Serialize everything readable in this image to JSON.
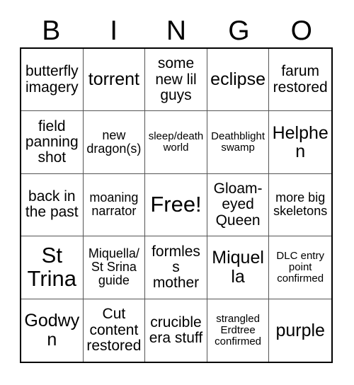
{
  "header": {
    "letters": [
      "B",
      "I",
      "N",
      "G",
      "O"
    ]
  },
  "grid": {
    "rows": 5,
    "columns": 5,
    "cells": [
      {
        "text": "butterfly imagery",
        "size": "lg",
        "free": false
      },
      {
        "text": "torrent",
        "size": "xl",
        "free": false
      },
      {
        "text": "some new lil guys",
        "size": "lg",
        "free": false
      },
      {
        "text": "eclipse",
        "size": "xl",
        "free": false
      },
      {
        "text": "farum restored",
        "size": "lg",
        "free": false
      },
      {
        "text": "field panning shot",
        "size": "lg",
        "free": false
      },
      {
        "text": "new dragon(s)",
        "size": "md",
        "free": false
      },
      {
        "text": "sleep/death world",
        "size": "sm",
        "free": false
      },
      {
        "text": "Deathblight swamp",
        "size": "sm",
        "free": false
      },
      {
        "text": "Helphen",
        "size": "xl",
        "free": false
      },
      {
        "text": "back in the past",
        "size": "lg",
        "free": false
      },
      {
        "text": "moaning narrator",
        "size": "md",
        "free": false
      },
      {
        "text": "Free!",
        "size": "xxl",
        "free": true
      },
      {
        "text": "Gloam-eyed Queen",
        "size": "lg",
        "free": false
      },
      {
        "text": "more big skeletons",
        "size": "md",
        "free": false
      },
      {
        "text": "St Trina",
        "size": "xxl",
        "free": false
      },
      {
        "text": "Miquella/ St Srina guide",
        "size": "md",
        "free": false
      },
      {
        "text": "formless mother",
        "size": "lg",
        "free": false
      },
      {
        "text": "Miquella",
        "size": "xl",
        "free": false
      },
      {
        "text": "DLC entry point confirmed",
        "size": "sm",
        "free": false
      },
      {
        "text": "Godwyn",
        "size": "xl",
        "free": false
      },
      {
        "text": "Cut content restored",
        "size": "lg",
        "free": false
      },
      {
        "text": "crucible era stuff",
        "size": "lg",
        "free": false
      },
      {
        "text": "strangled Erdtree confirmed",
        "size": "sm",
        "free": false
      },
      {
        "text": "purple",
        "size": "xl",
        "free": false
      }
    ]
  },
  "colors": {
    "background": "#ffffff",
    "text": "#000000",
    "outer_border": "#000000",
    "inner_border": "#555555"
  }
}
